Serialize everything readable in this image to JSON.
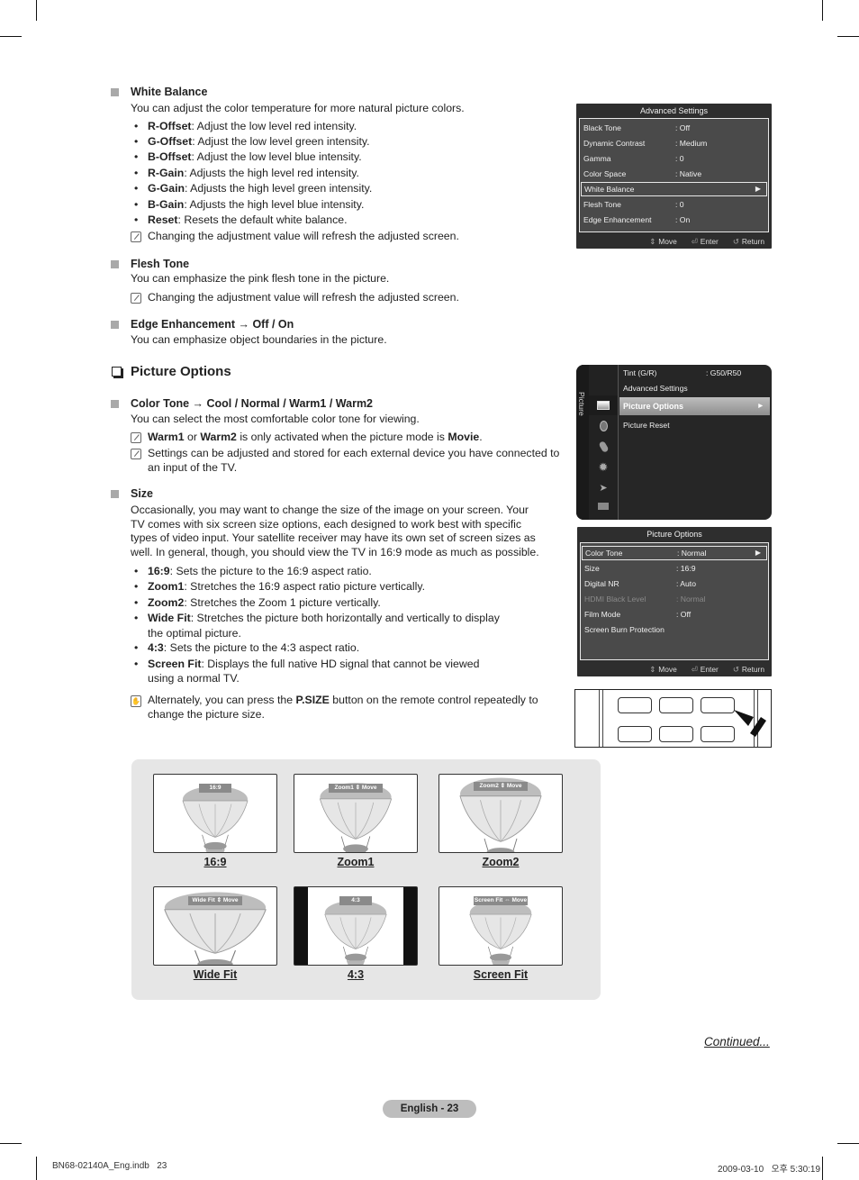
{
  "white_balance": {
    "heading": "White Balance",
    "desc": "You can adjust the color temperature for more natural picture colors.",
    "items": [
      {
        "term": "R-Offset",
        "text": ": Adjust the low level red intensity."
      },
      {
        "term": "G-Offset",
        "text": ": Adjust the low level green intensity."
      },
      {
        "term": "B-Offset",
        "text": ": Adjust the low level blue intensity."
      },
      {
        "term": "R-Gain",
        "text": ": Adjusts the high level red intensity."
      },
      {
        "term": "G-Gain",
        "text": ": Adjusts the high level green intensity."
      },
      {
        "term": "B-Gain",
        "text": ": Adjusts the high level blue intensity."
      },
      {
        "term": "Reset",
        "text": ": Resets the default white balance."
      }
    ],
    "note": "Changing the adjustment value will refresh the adjusted screen."
  },
  "flesh_tone": {
    "heading": "Flesh Tone",
    "desc": "You can emphasize the pink flesh tone in the picture.",
    "note": "Changing the adjustment value will refresh the adjusted screen."
  },
  "edge_enhancement": {
    "heading": "Edge Enhancement → Off / On",
    "desc": "You can emphasize object boundaries in the picture."
  },
  "picture_options_heading": "Picture Options",
  "color_tone": {
    "heading": "Color Tone → Cool / Normal / Warm1 / Warm2",
    "desc": "You can select the most comfortable color tone for viewing.",
    "note1": {
      "b1": "Warm1",
      "t1": " or ",
      "b2": "Warm2",
      "t2": " is only activated when the picture mode is ",
      "b3": "Movie",
      "t3": "."
    },
    "note2": "Settings can be adjusted and stored for each external device you have connected to an input of the TV."
  },
  "size": {
    "heading": "Size",
    "desc": "Occasionally, you may want to change the size of the image on your screen. Your TV comes with six screen size options, each designed to work best with specific types of video input. Your satellite receiver may have its own set of screen sizes as well. In general, though, you should view the TV in 16:9 mode as much as possible.",
    "items": [
      {
        "term": "16:9",
        "text": ": Sets the picture to the 16:9 aspect ratio.",
        "cont": ""
      },
      {
        "term": "Zoom1",
        "text": ": Stretches the 16:9 aspect ratio picture vertically.",
        "cont": ""
      },
      {
        "term": "Zoom2",
        "text": ": Stretches the Zoom 1 picture vertically.",
        "cont": ""
      },
      {
        "term": "Wide Fit",
        "text": ": Stretches the picture both horizontally and vertically to display",
        "cont": "the optimal picture."
      },
      {
        "term": "4:3",
        "text": ": Sets the picture to the 4:3 aspect ratio.",
        "cont": ""
      },
      {
        "term": "Screen Fit",
        "text": ": Displays the full native HD signal that cannot be viewed",
        "cont": "using a normal TV."
      }
    ],
    "tip": {
      "t1": "Alternately, you can press the ",
      "b": "P.SIZE",
      "t2": " button on the remote control repeatedly to change the picture size."
    }
  },
  "advanced_settings_osd": {
    "title": "Advanced Settings",
    "rows": [
      {
        "label": "Black Tone",
        "value": ": Off"
      },
      {
        "label": "Dynamic Contrast",
        "value": ": Medium"
      },
      {
        "label": "Gamma",
        "value": ": 0"
      },
      {
        "label": "Color Space",
        "value": ": Native"
      },
      {
        "label": "White Balance",
        "value": "",
        "selected": true
      },
      {
        "label": "Flesh Tone",
        "value": ": 0"
      },
      {
        "label": "Edge Enhancement",
        "value": ": On"
      }
    ],
    "footer": {
      "move": "Move",
      "enter": "Enter",
      "return": "Return"
    }
  },
  "picture_menu_osd": {
    "side_label": "Picture",
    "items": [
      {
        "label": "Tint (G/R)",
        "value": ": G50/R50"
      },
      {
        "label": "Advanced Settings",
        "value": ""
      },
      {
        "label": "Picture Options",
        "value": "",
        "selected": true
      },
      {
        "label": "Picture Reset",
        "value": ""
      }
    ],
    "icons": [
      "picture-icon",
      "sound-icon",
      "channel-icon",
      "setup-icon",
      "input-icon",
      "application-icon"
    ]
  },
  "picture_options_osd": {
    "title": "Picture Options",
    "rows": [
      {
        "label": "Color Tone",
        "value": ": Normal",
        "selected": true
      },
      {
        "label": "Size",
        "value": ": 16:9"
      },
      {
        "label": "Digital NR",
        "value": ": Auto"
      },
      {
        "label": "HDMI Black Level",
        "value": ": Normal",
        "disabled": true
      },
      {
        "label": "Film Mode",
        "value": ": Off"
      },
      {
        "label": "Screen Burn Protection",
        "value": ""
      }
    ],
    "footer": {
      "move": "Move",
      "enter": "Enter",
      "return": "Return"
    }
  },
  "gallery": [
    {
      "caption": "16:9",
      "tag": "16:9"
    },
    {
      "caption": "Zoom1",
      "tag": "Zoom1 ⇕ Move"
    },
    {
      "caption": "Zoom2",
      "tag": "Zoom2 ⇕ Move"
    },
    {
      "caption": "Wide Fit",
      "tag": "Wide Fit ⇕ Move"
    },
    {
      "caption": "4:3",
      "tag": "4:3"
    },
    {
      "caption": "Screen Fit",
      "tag": "Screen Fit ⇔ Move"
    }
  ],
  "continued": "Continued...",
  "page_badge": "English - 23",
  "footer": {
    "file": "BN68-02140A_Eng.indb   23",
    "timestamp": "2009-03-10   오후 5:30:19"
  }
}
